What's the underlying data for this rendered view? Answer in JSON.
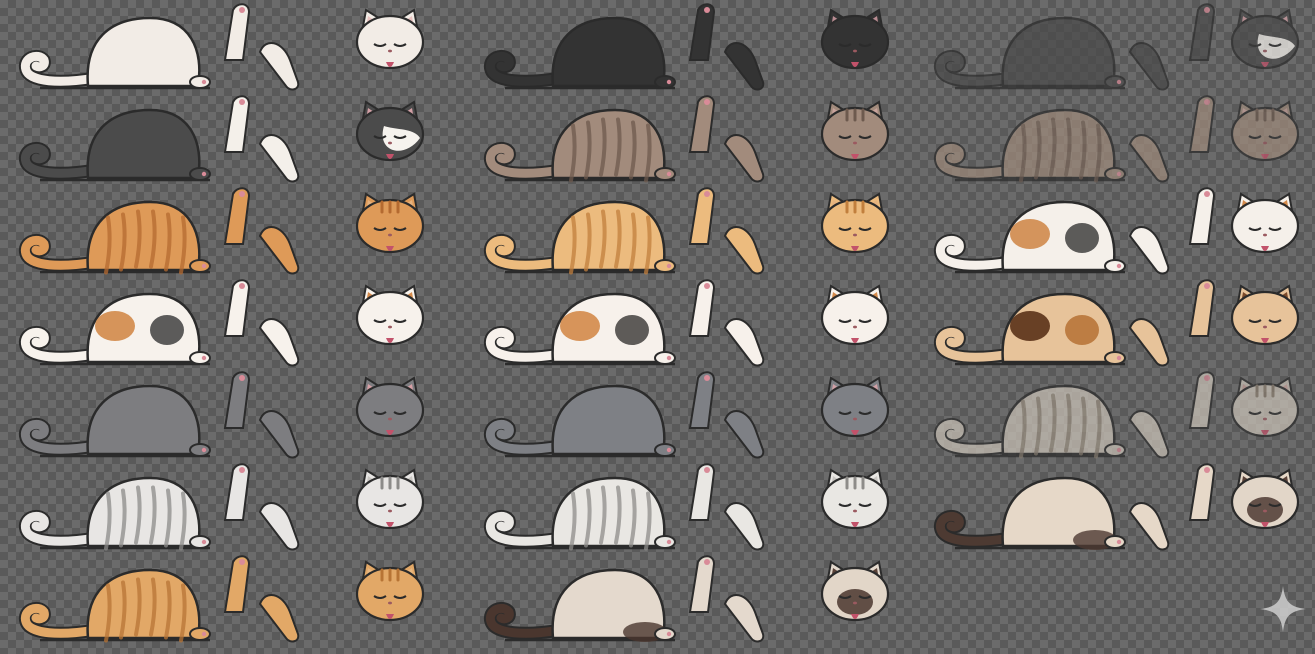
{
  "sheet": {
    "description_colors": {
      "outline": "#2b2b2b",
      "tongue": "#c2526a",
      "paw_pad": "#d98b98"
    },
    "columns": [
      {
        "rows": [
          {
            "base": "#f2ece6",
            "ear": "#e9c3c0",
            "patches": [],
            "stripes": null
          },
          {
            "base": "#4b4b4b",
            "ear": "#d3a0a6",
            "patches": [],
            "stripes": null,
            "head": "tuxedo",
            "paw": "#f4f0ea"
          },
          {
            "base": "#de9a58",
            "ear": "#e6b37f",
            "patches": [],
            "stripes": "#b46a30"
          },
          {
            "base": "#f7f2ec",
            "ear": "#d48a4b",
            "patches": [
              "#d18a4a",
              "#4a4a4a"
            ],
            "stripes": null
          },
          {
            "base": "#7d7d80",
            "ear": "#d7a0a6",
            "patches": [],
            "stripes": null
          },
          {
            "base": "#e8e6e4",
            "ear": "#c9c6c2",
            "patches": [],
            "stripes": "#8c8b89"
          },
          {
            "base": "#e2a867",
            "ear": "#e8b881",
            "patches": [],
            "stripes": "#b77435"
          }
        ]
      },
      {
        "rows": [
          {
            "base": "#333333",
            "ear": "#b98c92",
            "patches": [],
            "stripes": null
          },
          {
            "base": "#a28b7c",
            "ear": "#c8a39c",
            "patches": [],
            "stripes": "#6d5a4e"
          },
          {
            "base": "#ecbb7e",
            "ear": "#e6b37f",
            "patches": [],
            "stripes": "#c17f3d"
          },
          {
            "base": "#f7f1eb",
            "ear": "#d48a4b",
            "patches": [
              "#d3894a",
              "#4c4a48"
            ],
            "stripes": null
          },
          {
            "base": "#7e8085",
            "ear": "#d0a0a6",
            "patches": [],
            "stripes": null
          },
          {
            "base": "#e9e7e3",
            "ear": "#c9c6c2",
            "patches": [],
            "stripes": "#8e8c89"
          },
          {
            "base": "#e4d9cd",
            "ear": "#5a4238",
            "patches": [],
            "stripes": null,
            "point": "#4a362e"
          }
        ]
      },
      {
        "rows": [
          {
            "base": "#4a4a4a",
            "ear": "#d3a0a6",
            "patches": [],
            "stripes": null,
            "head": "tuxedo",
            "faded": true
          },
          {
            "base": "#9e8a7b",
            "ear": "#c8a39c",
            "patches": [],
            "stripes": "#6d5a4e",
            "faded": true
          },
          {
            "base": "#f5f0ea",
            "ear": "#d48a4b",
            "patches": [
              "#d08a4c",
              "#4b4a49"
            ],
            "stripes": null
          },
          {
            "base": "#e7c39a",
            "ear": "#7b4a2a",
            "patches": [
              "#5a3218",
              "#b8763a"
            ],
            "stripes": null,
            "tortie": true
          },
          {
            "base": "#c9c1b6",
            "ear": "#c8a39c",
            "patches": [],
            "stripes": "#8a7d6f",
            "faded": true
          },
          {
            "base": "#e6d8c8",
            "ear": "#5a4238",
            "patches": [],
            "stripes": null,
            "point": "#4d3a32"
          }
        ]
      }
    ]
  },
  "watermark": {
    "icon": "sparkle-icon",
    "color": "#c9c9c9"
  }
}
